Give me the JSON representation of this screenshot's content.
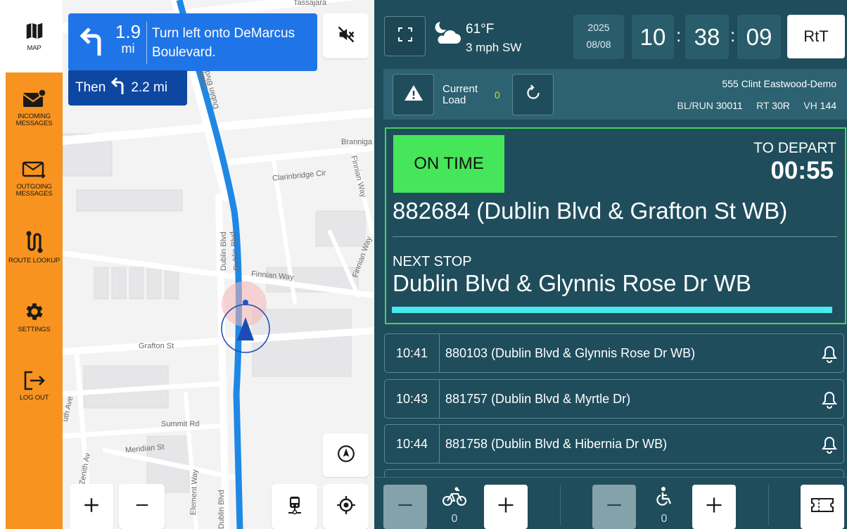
{
  "sidebar": {
    "items": [
      {
        "label": "MAP",
        "icon": "map-icon",
        "active": true
      },
      {
        "label": "INCOMING MESSAGES",
        "icon": "incoming-message-icon"
      },
      {
        "label": "OUTGOING MESSAGES",
        "icon": "outgoing-message-icon"
      },
      {
        "label": "ROUTE LOOKUP",
        "icon": "route-icon"
      },
      {
        "label": "SETTINGS",
        "icon": "gear-icon"
      },
      {
        "label": "LOG OUT",
        "icon": "logout-icon"
      }
    ]
  },
  "map": {
    "nav": {
      "distance": "1.9",
      "unit": "mi",
      "instruction": "Turn left onto DeMarcus Boulevard.",
      "then_label": "Then",
      "then_distance": "2.2 mi"
    },
    "streets": {
      "tassajara": "Tassajara",
      "dublin_blvd": "Dublin Blvd",
      "brannigan": "Branniga",
      "clarinbridge": "Clarinbridge Cir",
      "finnian_way": "Finnian Way",
      "grafton": "Grafton St",
      "summit": "Summit Rd",
      "meridian": "Meridian St",
      "zenith": "Zenith Av",
      "element": "Element Way",
      "south_ave": "uth Ave"
    },
    "colors": {
      "route": "#1e88e5",
      "nav_main": "#1f75e8",
      "nav_then": "#0d47a1"
    }
  },
  "header": {
    "weather": {
      "temp": "61°F",
      "wind": "3 mph SW",
      "icon": "partly-cloudy-night-icon"
    },
    "date": {
      "year": "2025",
      "day": "08/08"
    },
    "time": {
      "hour": "10",
      "minute": "38",
      "second": "09"
    },
    "rtt_label": "RtT"
  },
  "info": {
    "load_label": "Current Load",
    "load_value": "0",
    "operator": "555 Clint Eastwood-Demo",
    "blrun_label": "BL/RUN",
    "blrun_value": "30011",
    "rt_label": "RT",
    "rt_value": "30R",
    "vh_label": "VH",
    "vh_value": "144"
  },
  "current": {
    "status": "ON TIME",
    "depart_label": "TO DEPART",
    "depart_value": "00:55",
    "stop": "882684 (Dublin Blvd & Grafton St WB)",
    "next_label": "NEXT STOP",
    "next_stop": "Dublin Blvd & Glynnis Rose Dr WB",
    "status_color": "#46e65a"
  },
  "stops": [
    {
      "time": "10:41",
      "name": "880103 (Dublin Blvd & Glynnis Rose Dr WB)"
    },
    {
      "time": "10:43",
      "name": "881757 (Dublin Blvd & Myrtle Dr)"
    },
    {
      "time": "10:44",
      "name": "881758 (Dublin Blvd & Hibernia Dr WB)"
    }
  ],
  "counters": {
    "bike": {
      "value": "0",
      "icon": "bike-icon"
    },
    "wheelchair": {
      "value": "0",
      "icon": "wheelchair-icon"
    }
  }
}
